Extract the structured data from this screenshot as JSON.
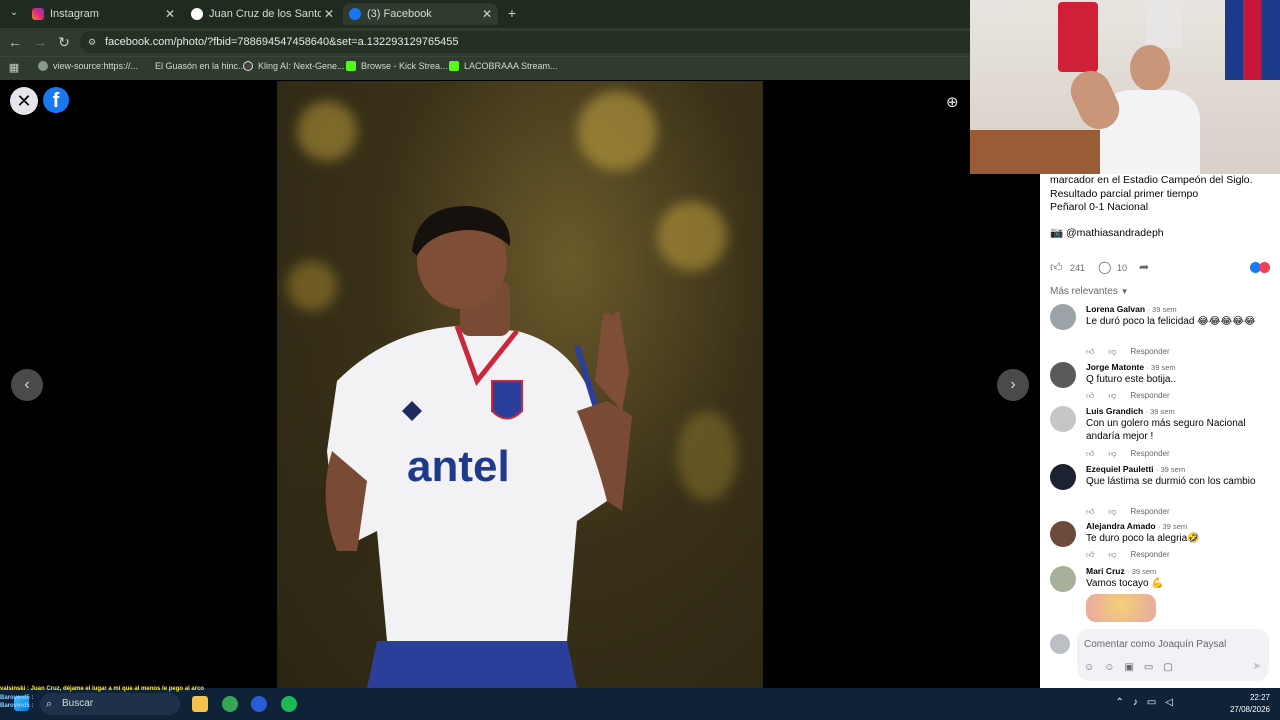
{
  "browser": {
    "tabs": [
      {
        "label": "Instagram",
        "favicon": "instagram-icon",
        "active": false
      },
      {
        "label": "Juan Cruz de los Santos campe",
        "favicon": "google-icon",
        "active": false
      },
      {
        "label": "(3) Facebook",
        "favicon": "facebook-icon",
        "active": true
      }
    ],
    "new_tab": "+",
    "url": "facebook.com/photo/?fbid=788694547458640&set=a.132293129765455",
    "bookmarks": [
      {
        "label": "view-source:https://...",
        "icon": "globe-icon"
      },
      {
        "label": "El Guasón en la hinc...",
        "icon": "none"
      },
      {
        "label": "Kling AI: Next-Gene...",
        "icon": "kling-icon"
      },
      {
        "label": "Browse - Kick Strea...",
        "icon": "kick-icon"
      },
      {
        "label": "LACOBRAAA Stream...",
        "icon": "kick-icon"
      }
    ]
  },
  "viewer": {
    "close_glyph": "✕",
    "logo_glyph": "f",
    "prev_glyph": "‹",
    "next_glyph": "›",
    "zoom_glyph": "⊕",
    "jersey_sponsor": "antel"
  },
  "post": {
    "caption_lines": [
      "marcador en el Estadio Campeón del Siglo.",
      "Resultado parcial primer tiempo",
      "Peñarol 0-1 Nacional"
    ],
    "credit": "📷 @mathiasandradeph",
    "likes": "241",
    "comments_count": "10",
    "sort_label": "Más relevantes",
    "comments": [
      {
        "name": "Lorena Galvan",
        "meta": "· 39 sem",
        "text": "Le duró poco la felicidad 😂😂😂😂😂",
        "reply": "Responder"
      },
      {
        "name": "Jorge Matonte",
        "meta": "· 39 sem",
        "text": "Q futuro este botija..",
        "reply": "Responder"
      },
      {
        "name": "Luis Grandich",
        "meta": "· 39 sem",
        "text": "Con un golero más seguro Nacional andaría mejor !",
        "reply": "Responder"
      },
      {
        "name": "Ezequiel Pauletti",
        "meta": "· 39 sem",
        "text": "Que lástima se durmió con los cambio",
        "reply": "Responder"
      },
      {
        "name": "Alejandra Amado",
        "meta": "· 39 sem",
        "text": "Te duro poco la alegria🤣",
        "reply": "Responder"
      },
      {
        "name": "Mari Cruz",
        "meta": "· 39 sem",
        "text": "Vamos tocayo 💪",
        "reply": ""
      }
    ],
    "composer_placeholder": "Comentar como Joaquín Paysal"
  },
  "stream": {
    "chat_lines": [
      "valsinski : Juan Cruz, déjame el lugar a mí que al menos le pego al arco",
      "Baroverd5 :",
      "Baroverd5 :"
    ]
  },
  "taskbar": {
    "search_label": "Buscar",
    "time": "22:27",
    "date": "27/08/2026"
  },
  "colors": {
    "facebook_blue": "#1877f2",
    "taskbar": "#0e2338",
    "chrome": "#2e3b2e"
  }
}
